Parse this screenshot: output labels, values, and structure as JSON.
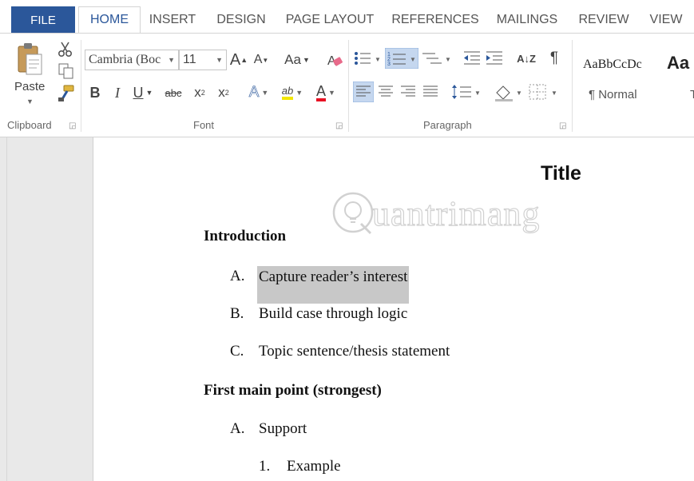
{
  "tabs": {
    "file": "FILE",
    "items": [
      {
        "label": "HOME",
        "active": true
      },
      {
        "label": "INSERT"
      },
      {
        "label": "DESIGN"
      },
      {
        "label": "PAGE LAYOUT"
      },
      {
        "label": "REFERENCES"
      },
      {
        "label": "MAILINGS"
      },
      {
        "label": "REVIEW"
      },
      {
        "label": "VIEW"
      }
    ]
  },
  "ribbon": {
    "clipboard": {
      "paste_label": "Paste",
      "group_label": "Clipboard",
      "icons": [
        "paste-icon",
        "cut-icon",
        "copy-icon",
        "format-painter-icon"
      ]
    },
    "font": {
      "font_name": "Cambria (Boc",
      "font_size": "11",
      "grow_label": "A",
      "shrink_label": "A",
      "change_case_label": "Aa",
      "bold_label": "B",
      "italic_label": "I",
      "underline_label": "U",
      "strike_label": "abc",
      "subscript_label": "x",
      "superscript_label": "x",
      "text_effects_label": "A",
      "highlight_label": "ab",
      "font_color_label": "A",
      "group_label": "Font",
      "highlight_color": "#f2e600",
      "font_color": "#e81123"
    },
    "paragraph": {
      "group_label": "Paragraph",
      "sort_label": "A↓Z",
      "pilcrow_label": "¶"
    },
    "styles": {
      "sample_1": "AaBbCcDc",
      "sample_2": "Aa",
      "name_1": "¶ Normal",
      "name_2": "T"
    }
  },
  "document": {
    "title": "Title",
    "watermark": "uantrimang",
    "sections": [
      {
        "heading": "Introduction",
        "items": [
          {
            "marker": "A.",
            "text": "Capture reader’s interest",
            "selected": true
          },
          {
            "marker": "B.",
            "text": "Build case through logic"
          },
          {
            "marker": "C.",
            "text": "Topic sentence/thesis statement"
          }
        ]
      },
      {
        "heading": "First main point (strongest)",
        "items": [
          {
            "marker": "A.",
            "text": "Support"
          },
          {
            "marker": "1.",
            "text": "Example"
          }
        ]
      }
    ]
  },
  "colors": {
    "accent": "#2b579a",
    "selection": "#c8c8c8",
    "active_button": "#c5d7ef"
  }
}
